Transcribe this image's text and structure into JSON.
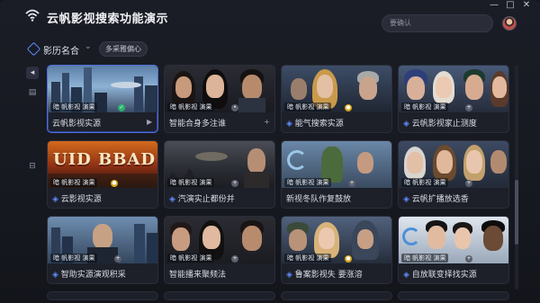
{
  "app": {
    "title": "云帆影视搜索功能演示"
  },
  "window_controls": {
    "minimize": "—",
    "maximize": "□",
    "close": "✕"
  },
  "search": {
    "placeholder": "要确认"
  },
  "filter": {
    "label": "影历名合",
    "chip": "多采雅偏心"
  },
  "rail": {
    "items": [
      "◂",
      "▤",
      "⊟"
    ]
  },
  "cards": [
    {
      "overlay": "暗 帆影视 演果",
      "title": "云帆影视实源",
      "prefix": "",
      "action": "▶",
      "dot": "#2ab36d",
      "dot_glyph": "✓"
    },
    {
      "overlay": "暗 帆影视 演果",
      "title": "智能合身多注谁",
      "prefix": "",
      "action": "+",
      "dot": "#5a5f6d",
      "dot_glyph": "•"
    },
    {
      "overlay": "暗 帆影视 演果",
      "title": "能气搜索实源",
      "prefix": "◈",
      "action": "",
      "dot": "#d7a416",
      "dot_glyph": "●"
    },
    {
      "overlay": "暗 帆影视 演果",
      "title": "云帆影视家止测度",
      "prefix": "◈",
      "action": "",
      "dot": "#5a5f6d",
      "dot_glyph": "+"
    },
    {
      "overlay": "暗 帆影视 演果",
      "title": "云影视实源",
      "prefix": "◈",
      "action": "",
      "dot": "#d7a416",
      "dot_glyph": "●"
    },
    {
      "overlay": "暗 帆影视 演果",
      "title": "汽演实止都份并",
      "prefix": "◈",
      "action": "",
      "dot": "#5a5f6d",
      "dot_glyph": "+"
    },
    {
      "overlay": "暗 帆影视 演果",
      "title": "新视冬队作复鼓放",
      "prefix": "",
      "action": "",
      "dot": "#5a5f6d",
      "dot_glyph": "+"
    },
    {
      "overlay": "暗 帆影视 演果",
      "title": "云帆扩播放选香",
      "prefix": "◈",
      "action": "",
      "dot": "#5a5f6d",
      "dot_glyph": "+"
    },
    {
      "overlay": "暗 帆影视 演果",
      "title": "智助实源演观积采",
      "prefix": "◈",
      "action": "",
      "dot": "#5a5f6d",
      "dot_glyph": "+"
    },
    {
      "overlay": "暗 帆影视 演果",
      "title": "智能播来聚频法",
      "prefix": "",
      "action": "",
      "dot": "#5a5f6d",
      "dot_glyph": "+"
    },
    {
      "overlay": "暗 帆影视 演果",
      "title": "鲁案影视失 要涨溶",
      "prefix": "◈",
      "action": "",
      "dot": "#d7a416",
      "dot_glyph": "●"
    },
    {
      "overlay": "暗 帆影视 演果",
      "title": "自放联变择找实源",
      "prefix": "◈",
      "action": "",
      "dot": "#5a5f6d",
      "dot_glyph": "+"
    }
  ],
  "thumb_text": "UID BBAD",
  "colors": {
    "accent": "#5f8dff",
    "selected_border": "#4f6ed6",
    "bg": "#171921"
  }
}
